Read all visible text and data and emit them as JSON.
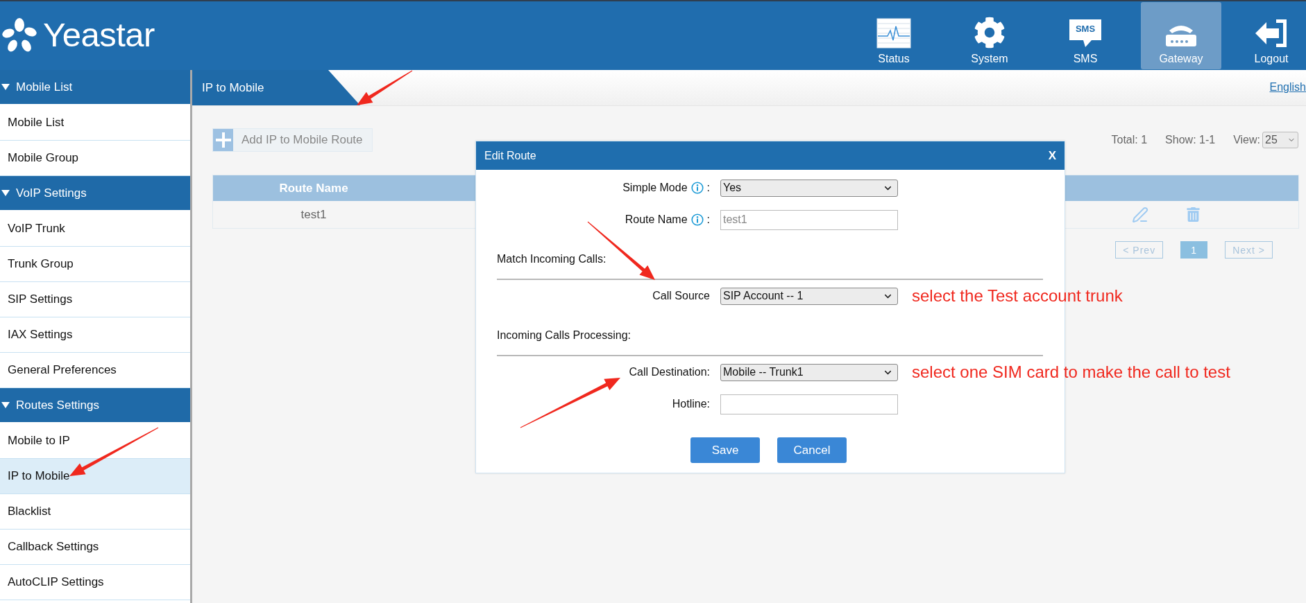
{
  "header": {
    "logo": "Yeastar",
    "nav": [
      {
        "kind": "status",
        "label": "Status",
        "selected": false
      },
      {
        "kind": "system",
        "label": "System",
        "selected": false
      },
      {
        "kind": "sms",
        "label": "SMS",
        "icon_text": "SMS",
        "selected": false
      },
      {
        "kind": "gateway",
        "label": "Gateway",
        "selected": true
      },
      {
        "kind": "logout",
        "label": "Logout",
        "selected": false
      }
    ]
  },
  "sidebar": {
    "groups": [
      {
        "title": "Mobile List",
        "expanded": true,
        "items": [
          {
            "label": "Mobile List",
            "selected": false
          },
          {
            "label": "Mobile Group",
            "selected": false
          }
        ]
      },
      {
        "title": "VoIP Settings",
        "expanded": true,
        "items": [
          {
            "label": "VoIP Trunk",
            "selected": false
          },
          {
            "label": "Trunk Group",
            "selected": false
          },
          {
            "label": "SIP Settings",
            "selected": false
          },
          {
            "label": "IAX Settings",
            "selected": false
          },
          {
            "label": "General Preferences",
            "selected": false
          }
        ]
      },
      {
        "title": "Routes Settings",
        "expanded": true,
        "items": [
          {
            "label": "Mobile to IP",
            "selected": false
          },
          {
            "label": "IP to Mobile",
            "selected": true
          },
          {
            "label": "Blacklist",
            "selected": false
          },
          {
            "label": "Callback Settings",
            "selected": false
          },
          {
            "label": "AutoCLIP Settings",
            "selected": false
          }
        ]
      }
    ]
  },
  "breadcrumb": {
    "title": "IP to Mobile",
    "language": "English"
  },
  "toolbar": {
    "add_button": "Add IP to Mobile Route",
    "total": "Total: 1",
    "show": "Show: 1-1",
    "view_label": "View:",
    "view_value": "25"
  },
  "table": {
    "columns": [
      "Route Name"
    ],
    "rows": [
      {
        "cells": [
          "test1"
        ]
      }
    ]
  },
  "pagination": {
    "prev": "< Prev",
    "pages": [
      {
        "label": "1",
        "selected": true
      }
    ],
    "next": "Next >"
  },
  "dialog": {
    "title": "Edit Route",
    "close": "X",
    "rows": [
      {
        "kind": "select",
        "label": "Simple Mode",
        "info": true,
        "separator": ":",
        "value": "Yes"
      },
      {
        "kind": "input",
        "label": "Route Name",
        "info": true,
        "separator": ":",
        "value": "test1",
        "disabled": true
      },
      {
        "kind": "section",
        "label": "Match Incoming Calls:"
      },
      {
        "kind": "select",
        "label": "Call Source",
        "value": "SIP Account -- 1",
        "annotation": "select the Test account trunk"
      },
      {
        "kind": "section",
        "label": "Incoming Calls Processing:"
      },
      {
        "kind": "select",
        "label": "Call Destination:",
        "value": "Mobile -- Trunk1",
        "annotation": "select one SIM card to make the call to test"
      },
      {
        "kind": "input",
        "label": "Hotline:"
      }
    ],
    "buttons": [
      "Save",
      "Cancel"
    ]
  }
}
